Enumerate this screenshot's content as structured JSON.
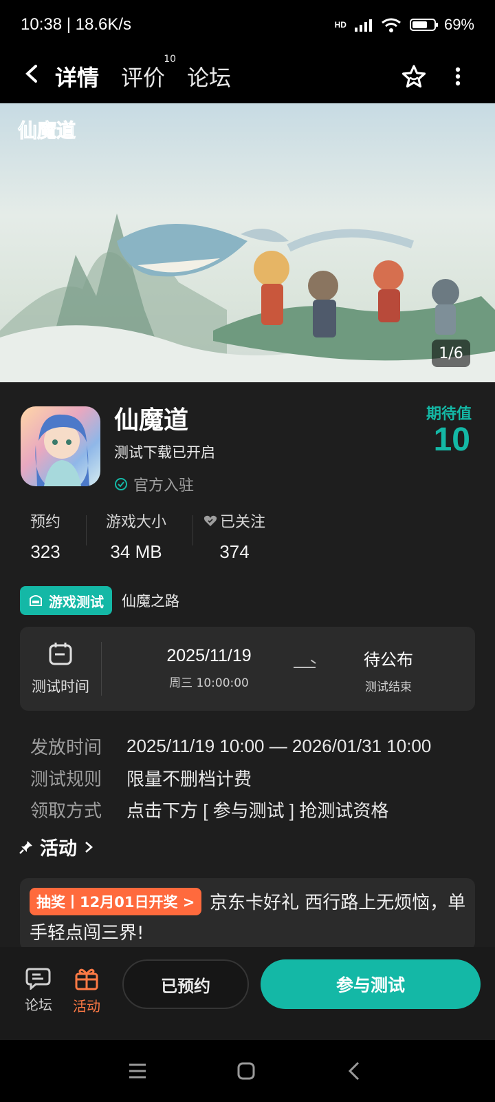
{
  "status_bar": {
    "time_speed": "10:38 | 18.6K/s",
    "network": "HD",
    "battery_text": "69%",
    "battery_level": 0.69
  },
  "nav": {
    "tabs": [
      {
        "label": "详情",
        "active": true
      },
      {
        "label": "评价",
        "badge": "10"
      },
      {
        "label": "论坛"
      }
    ]
  },
  "banner": {
    "logo_text": "仙魔道",
    "counter": "1/6"
  },
  "app": {
    "name": "仙魔道",
    "subtitle": "测试下载已开启",
    "official": "官方入驻",
    "expect_label": "期待值",
    "expect_value": "10"
  },
  "stats": [
    {
      "label": "预约",
      "value": "323"
    },
    {
      "label": "游戏大小",
      "value": "34 MB"
    },
    {
      "label": "已关注",
      "value": "374"
    }
  ],
  "test": {
    "tag": "游戏测试",
    "name": "仙魔之路",
    "time_label": "测试时间",
    "start_date": "2025/11/19",
    "start_sub": "周三  10:00:00",
    "end_title": "待公布",
    "end_sub": "测试结束"
  },
  "info": [
    {
      "key": "发放时间",
      "value": "2025/11/19 10:00 — 2026/01/31 10:00"
    },
    {
      "key": "测试规则",
      "value": "限量不删档计费"
    },
    {
      "key": "领取方式",
      "value": "点击下方 [ 参与测试 ] 抢测试资格"
    }
  ],
  "activity": {
    "header": "活动",
    "tag": "抽奖丨12月01日开奖 >",
    "text": "京东卡好礼 西行路上无烦恼，单手轻点闯三界!"
  },
  "bottom": {
    "forum_label": "论坛",
    "activity_label": "活动",
    "reserved_label": "已预约",
    "join_label": "参与测试"
  },
  "colors": {
    "accent": "#14b8a6",
    "orange": "#ff6a3d",
    "bg": "#1e1e1e"
  }
}
